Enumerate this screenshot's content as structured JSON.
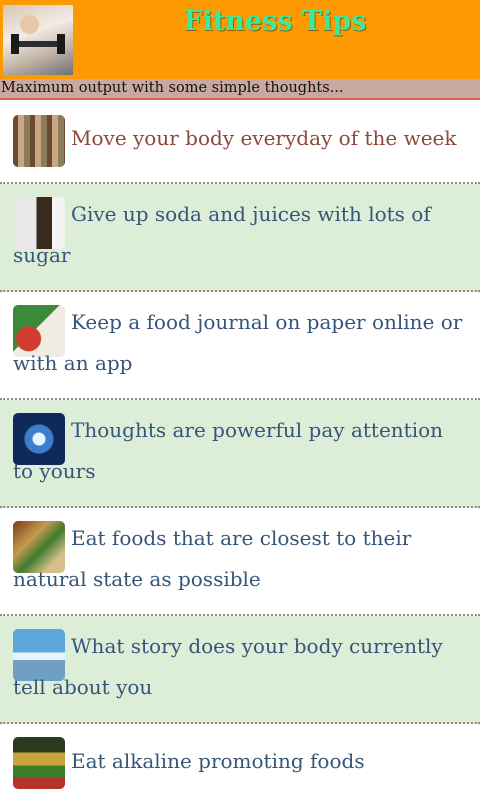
{
  "header": {
    "title": "Fitness Tips",
    "image_icon": "woman-lifting-dumbbell-photo"
  },
  "subtitle": "Maximum output with some simple thoughts...",
  "tips": [
    {
      "text": "Move your body everyday of the week",
      "icon": "exercise-poses-thumbnail"
    },
    {
      "text": "Give up soda and juices with lots of sugar",
      "icon": "soda-and-sugar-thumbnail"
    },
    {
      "text": "Keep a food journal on paper online or with an app",
      "icon": "food-journal-thumbnail"
    },
    {
      "text": "Thoughts are powerful pay attention to yours",
      "icon": "meditation-figure-thumbnail"
    },
    {
      "text": "Eat foods that are closest to their natural state as possible",
      "icon": "natural-foods-thumbnail"
    },
    {
      "text": "What story does your body currently tell about you",
      "icon": "beach-stretch-thumbnail"
    },
    {
      "text": "Eat alkaline promoting foods",
      "icon": "vegetables-thumbnail"
    }
  ],
  "colors": {
    "header_bg": "#fd9a01",
    "title": "#3ee79a",
    "subtitle_bg": "#c9a89f",
    "row_green": "#dcedd8",
    "text": "#37557a",
    "first_text": "#8a4a3c"
  }
}
